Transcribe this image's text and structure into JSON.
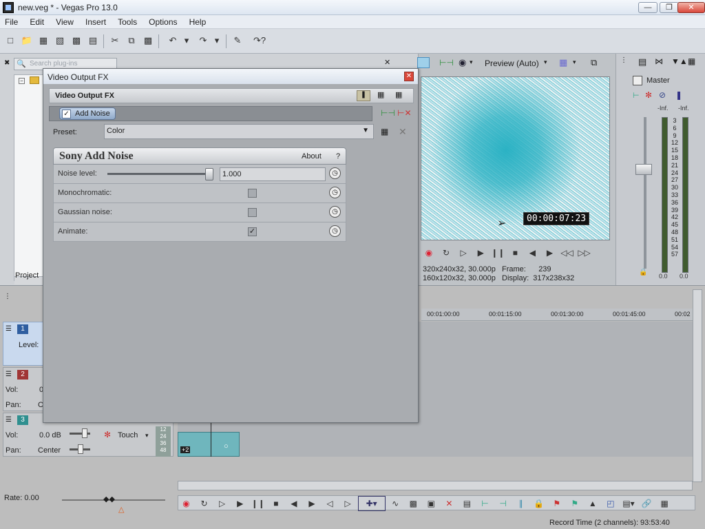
{
  "window": {
    "title": "new.veg * - Vegas Pro 13.0"
  },
  "menu": [
    "File",
    "Edit",
    "View",
    "Insert",
    "Tools",
    "Options",
    "Help"
  ],
  "plugin_browser": {
    "search_placeholder": "Search plug-ins",
    "tab_project": "Project"
  },
  "preview": {
    "mode_label": "Preview (Auto)",
    "timecode": "00:00:07:23",
    "info": {
      "project_label": "320x240x32, 30.000p",
      "preview_label": "160x120x32, 30.000p",
      "frame_label": "Frame:",
      "frame_value": "239",
      "display_label": "Display:",
      "display_value": "317x238x32"
    }
  },
  "mixer": {
    "master_label": "Master",
    "inf_left": "-Inf.",
    "inf_right": "-Inf.",
    "scale": [
      "3",
      "6",
      "9",
      "12",
      "15",
      "18",
      "21",
      "24",
      "27",
      "30",
      "33",
      "36",
      "39",
      "42",
      "45",
      "48",
      "51",
      "54",
      "57"
    ],
    "val_left": "0.0",
    "val_right": "0.0"
  },
  "timeline": {
    "ruler": [
      "00:01:00:00",
      "00:01:15:00",
      "00:01:30:00",
      "00:01:45:00",
      "00:02"
    ],
    "tracks": [
      {
        "num": "1",
        "type": "video",
        "level_label": "Level:"
      },
      {
        "num": "2",
        "type": "audio",
        "vol_label": "Vol:",
        "vol_value": "0",
        "pan_label": "Pan:",
        "pan_value": "C"
      },
      {
        "num": "3",
        "type": "audio",
        "vol_label": "Vol:",
        "vol_value": "0.0 dB",
        "pan_label": "Pan:",
        "pan_value": "Center",
        "automation_label": "Touch"
      }
    ],
    "clip_levels": [
      "12",
      "24",
      "36",
      "48"
    ],
    "clip_badge": "+2",
    "rate_label": "Rate: 0.00",
    "status": "Record Time (2 channels): 93:53:40"
  },
  "fx_dialog": {
    "title": "Video Output FX",
    "chain_title": "Video Output FX",
    "plugin_name": "Add Noise",
    "preset_label": "Preset:",
    "preset_value": "Color",
    "panel_title": "Sony Add Noise",
    "about_label": "About",
    "help_label": "?",
    "params": [
      {
        "label": "Noise level:",
        "value": "1.000",
        "kind": "slider",
        "fraction": 1.0
      },
      {
        "label": "Monochromatic:",
        "kind": "checkbox",
        "checked": false
      },
      {
        "label": "Gaussian noise:",
        "kind": "checkbox",
        "checked": false
      },
      {
        "label": "Animate:",
        "kind": "checkbox",
        "checked": true
      }
    ]
  },
  "colors": {
    "track_video": "#2f5ea0",
    "track_audio_red": "#a03535",
    "track_audio_teal": "#2f8f8f",
    "clip_teal": "#6fb6bd"
  }
}
